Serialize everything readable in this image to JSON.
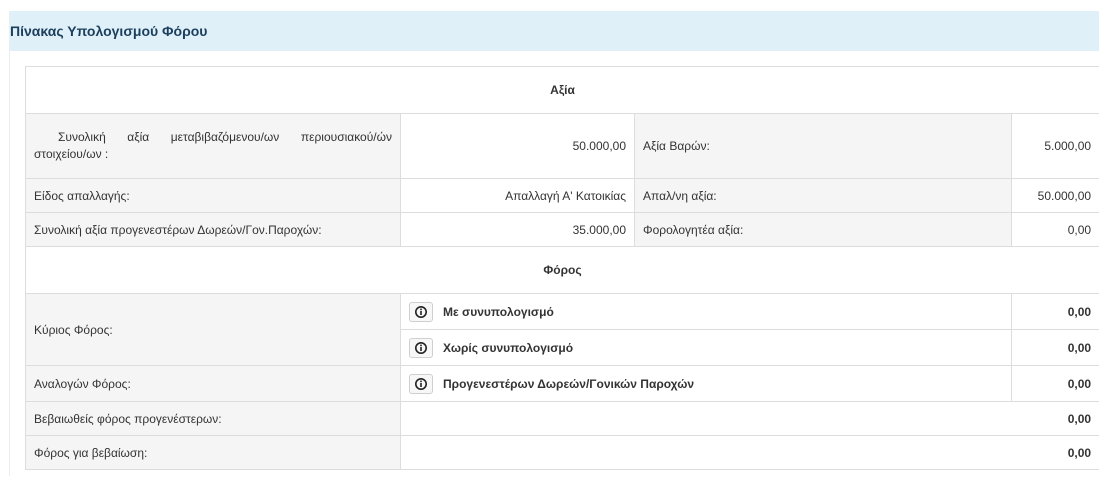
{
  "panel": {
    "title": "Πίνακας Υπολογισμού Φόρου"
  },
  "sections": {
    "value_header": "Αξία",
    "tax_header": "Φόρος"
  },
  "value_rows": [
    {
      "label": "Συνολική αξία μεταβιβαζόμενου/ων περιουσιακού/ών στοιχείου/ων :",
      "value": "50.000,00",
      "label2": "Αξία Βαρών:",
      "value2": "5.000,00"
    },
    {
      "label": "Είδος απαλλαγής:",
      "value": "Απαλλαγή Α' Κατοικίας",
      "label2": "Απαλ/νη αξία:",
      "value2": "50.000,00"
    },
    {
      "label": "Συνολική αξία προγενεστέρων Δωρεών/Γον.Παροχών:",
      "value": "35.000,00",
      "label2": "Φορολογητέα αξία:",
      "value2": "0,00"
    }
  ],
  "tax_rows": {
    "main_tax": {
      "label": "Κύριος Φόρος:",
      "options": [
        {
          "text": "Με συνυπολογισμό",
          "amount": "0,00",
          "icon": "info-icon"
        },
        {
          "text": "Χωρίς συνυπολογισμό",
          "amount": "0,00",
          "icon": "info-icon"
        }
      ]
    },
    "proportional_tax": {
      "label": "Αναλογών Φόρος:",
      "option": {
        "text": "Προγενεστέρων Δωρεών/Γονικών Παροχών",
        "amount": "0,00",
        "icon": "info-icon"
      }
    },
    "certified_prior": {
      "label": "Βεβαιωθείς φόρος προγενέστερων:",
      "amount": "0,00"
    },
    "tax_to_certify": {
      "label": "Φόρος για βεβαίωση:",
      "amount": "0,00"
    }
  },
  "colors": {
    "heading_bg": "#dff0f8",
    "heading_text": "#1c3f5e",
    "label_bg": "#f5f5f5",
    "border": "#dddddd"
  }
}
